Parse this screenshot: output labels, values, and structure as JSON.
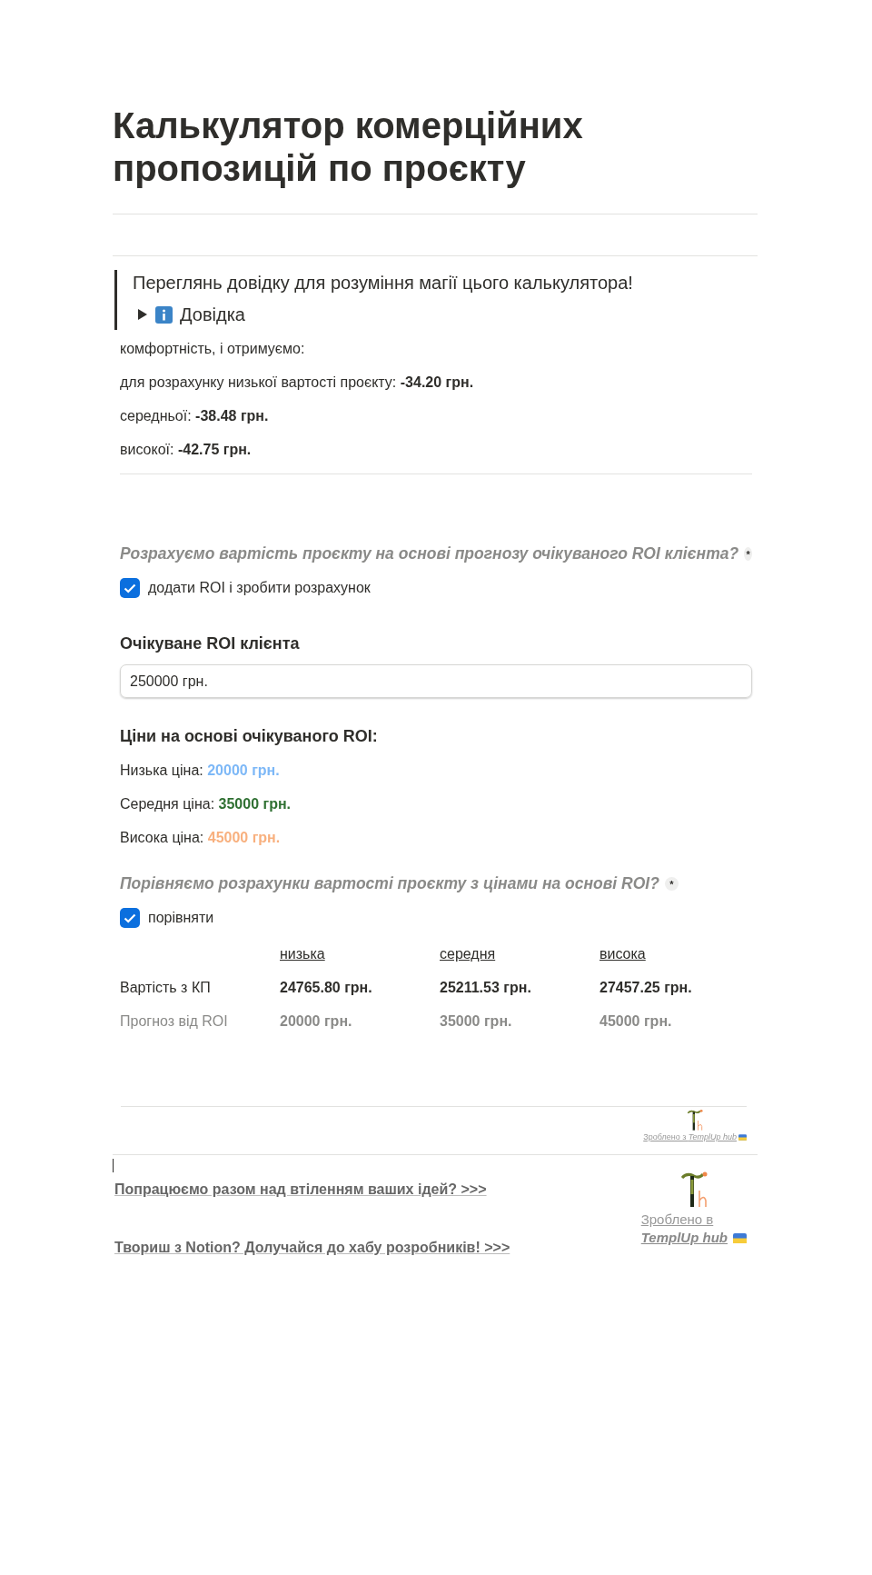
{
  "title": "Калькулятор комерційних пропозицій по проєкту",
  "callout": {
    "text": "Переглянь довідку для розуміння магії цього калькулятора!",
    "toggle": {
      "label": "Довідка",
      "expanded": false
    }
  },
  "results": [
    "комфортність, і отримуємо:",
    "для розрахунку низької вартості проєкту: **-34.20 грн.**",
    "середньої: **-38.48 грн.**",
    "високої: **-42.75 грн.**"
  ],
  "roi_section": {
    "question": "Розрахуємо вартість проєкту на основі прогнозу очікуваного ROI клієнта?",
    "marker": "*",
    "checkbox": {
      "label": "додати ROI і зробити розрахунок",
      "checked": true
    },
    "field_label": "Очікуване ROI клієнта",
    "field_value": "250000 грн.",
    "prices_heading": "Ціни на основі очікуваного ROI:",
    "prices": [
      {
        "label": "Низька ціна:",
        "value": "20000 грн.",
        "color": "#7db8f7"
      },
      {
        "label": "Середня ціна:",
        "value": "35000 грн.",
        "color": "#2f7032"
      },
      {
        "label": "Висока ціна:",
        "value": "45000 грн.",
        "color": "#f8b07e"
      }
    ]
  },
  "compare_section": {
    "question": "Порівняємо розрахунки вартості проєкту з цінами на основі ROI?",
    "marker": "*",
    "checkbox": {
      "label": "порівняти",
      "checked": true
    },
    "columns": [
      "низька",
      "середня",
      "висока"
    ],
    "rows": [
      {
        "label": "Вартість з КП",
        "kind": "primary",
        "cells": [
          "24765.80 грн.",
          "25211.53 грн.",
          "27457.25 грн."
        ]
      },
      {
        "label": "Прогноз від ROI",
        "kind": "muted",
        "cells": [
          "20000 грн.",
          "35000 грн.",
          "45000 грн."
        ]
      }
    ]
  },
  "footer": {
    "badge_text": "Зроблено з *TemplUp hub*",
    "links": [
      "Попрацюємо разом над втіленням ваших ідей? >>>",
      "Твориш з Notion? Долучайся до хабу розробників! >>>"
    ],
    "credit": {
      "line1": "Зроблено в",
      "line2": "TemplUp hub"
    }
  }
}
